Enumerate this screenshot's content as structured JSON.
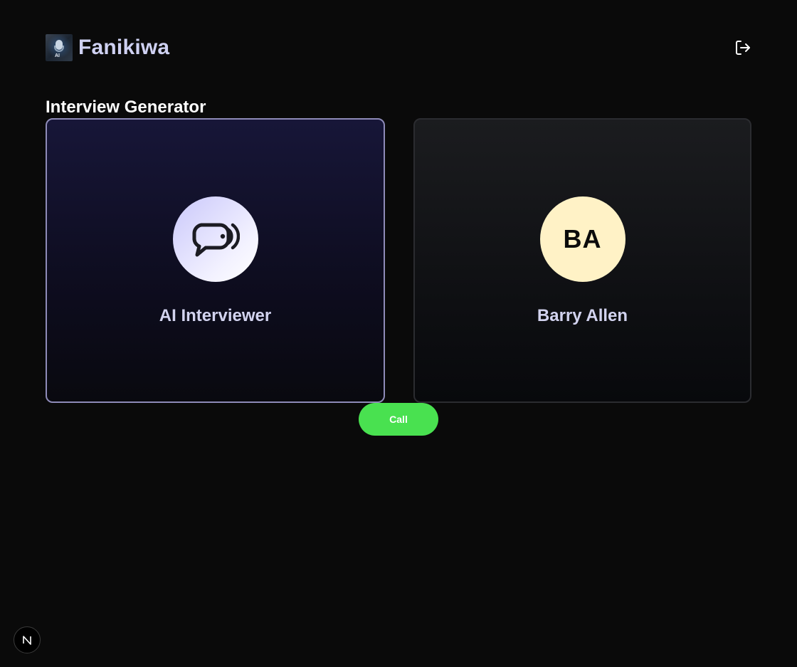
{
  "header": {
    "brand_name": "Fanikiwa",
    "logo_text": "AI",
    "logout_icon": "logout-icon"
  },
  "page": {
    "title": "Interview Generator"
  },
  "cards": {
    "ai": {
      "label": "AI Interviewer",
      "icon": "speech-bubble-sound-icon"
    },
    "user": {
      "initials": "BA",
      "name": "Barry Allen"
    }
  },
  "actions": {
    "call_label": "Call"
  },
  "colors": {
    "background": "#0a0a0a",
    "brand_text": "#cfd1f2",
    "call_button": "#49e150",
    "user_avatar": "#fff2c6",
    "ai_card_border": "#8e8bb8"
  },
  "dev_badge": {
    "icon": "next-logo-icon"
  }
}
